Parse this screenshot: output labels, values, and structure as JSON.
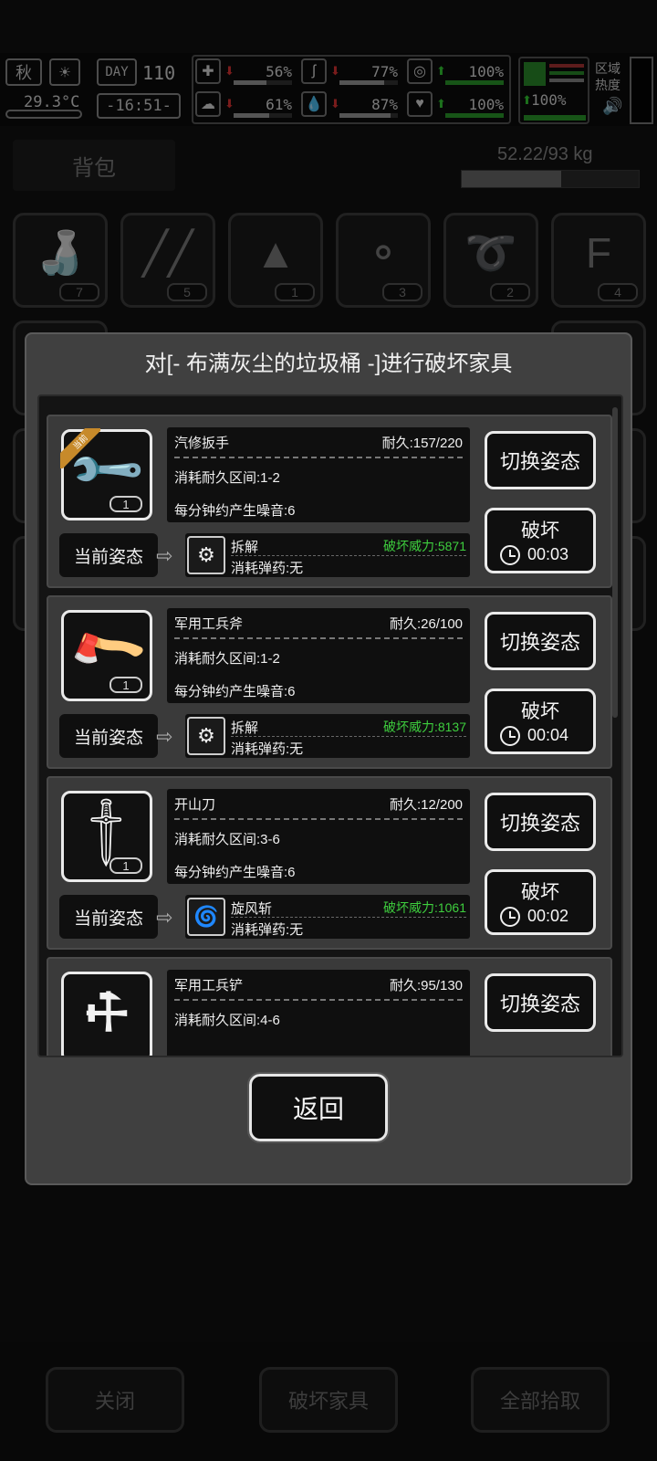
{
  "hud": {
    "season": "秋",
    "day_label": "DAY",
    "day_number": "110",
    "temperature": "29.3°C",
    "clock": "-16:51-",
    "stats": [
      {
        "icon": "medkit-icon",
        "glyph": "✚",
        "trend": "down",
        "value": "56%",
        "level": 0.56
      },
      {
        "icon": "stomach-icon",
        "glyph": "ʃ",
        "trend": "down",
        "value": "77%",
        "level": 0.77
      },
      {
        "icon": "stamina-icon",
        "glyph": "◎",
        "trend": "up",
        "value": "100%",
        "level": 1.0
      },
      {
        "icon": "brain-icon",
        "glyph": "☁",
        "trend": "down",
        "value": "61%",
        "level": 0.61
      },
      {
        "icon": "water-drop-icon",
        "glyph": "💧",
        "trend": "down",
        "value": "87%",
        "level": 0.87
      },
      {
        "icon": "heart-icon",
        "glyph": "♥",
        "trend": "up",
        "value": "100%",
        "level": 1.0
      }
    ],
    "status_value": "100%",
    "region_heat_label": "区域热度"
  },
  "backpack": {
    "title": "背包",
    "weight": "52.22/93 kg",
    "weight_fraction": 0.56,
    "items": [
      {
        "icon": "water-bottle-icon",
        "glyph": "🍶",
        "count": "7"
      },
      {
        "icon": "chopsticks-icon",
        "glyph": "╱╱",
        "count": "5"
      },
      {
        "icon": "cloth-rag-icon",
        "glyph": "▲",
        "count": "1"
      },
      {
        "icon": "meat-skewer-icon",
        "glyph": "⚬",
        "count": "3"
      },
      {
        "icon": "rope-icon",
        "glyph": "➰",
        "count": "2"
      },
      {
        "icon": "fertilizer-bag-icon",
        "glyph": "F",
        "count": "4"
      }
    ],
    "bottom_buttons": [
      "关闭",
      "破坏家具",
      "全部拾取"
    ]
  },
  "modal": {
    "title": "对[- 布满灰尘的垃圾桶 -]进行破坏家具",
    "stance_label": "当前姿态",
    "switch_label": "切换姿态",
    "break_label": "破坏",
    "equipped_tag": "当前",
    "return_label": "返回",
    "tools": [
      {
        "name": "汽修扳手",
        "durability": "耐久:157/220",
        "cost": "消耗耐久区间:1-2",
        "noise": "每分钟约产生噪音:6",
        "count": "1",
        "stance": "拆解",
        "power": "破坏威力:5871",
        "ammo": "消耗弹药:无",
        "time": "00:03",
        "icon": "wrench-icon",
        "glyph": "🔧",
        "stance_icon": "tools-gear-icon",
        "stance_glyph": "⚙",
        "equipped": true
      },
      {
        "name": "军用工兵斧",
        "durability": "耐久:26/100",
        "cost": "消耗耐久区间:1-2",
        "noise": "每分钟约产生噪音:6",
        "count": "1",
        "stance": "拆解",
        "power": "破坏威力:8137",
        "ammo": "消耗弹药:无",
        "time": "00:04",
        "icon": "axe-icon",
        "glyph": "🪓",
        "stance_icon": "tools-gear-icon",
        "stance_glyph": "⚙",
        "equipped": false
      },
      {
        "name": "开山刀",
        "durability": "耐久:12/200",
        "cost": "消耗耐久区间:3-6",
        "noise": "每分钟约产生噪音:6",
        "count": "1",
        "stance": "旋风斩",
        "power": "破坏威力:1061",
        "ammo": "消耗弹药:无",
        "time": "00:02",
        "icon": "machete-icon",
        "glyph": "🗡",
        "stance_icon": "whirlwind-icon",
        "stance_glyph": "🌀",
        "equipped": false
      },
      {
        "name": "军用工兵铲",
        "durability": "耐久:95/130",
        "cost": "消耗耐久区间:4-6",
        "noise": "",
        "count": "",
        "stance": "",
        "power": "",
        "ammo": "",
        "time": "",
        "icon": "shovel-icon",
        "glyph": "⚒",
        "stance_icon": "",
        "stance_glyph": "",
        "equipped": false
      }
    ]
  },
  "colors": {
    "power_green": "#3ecf3e",
    "equipped_tag": "#c78a2a",
    "trend_down": "#dd3333",
    "trend_up": "#33cc33"
  }
}
